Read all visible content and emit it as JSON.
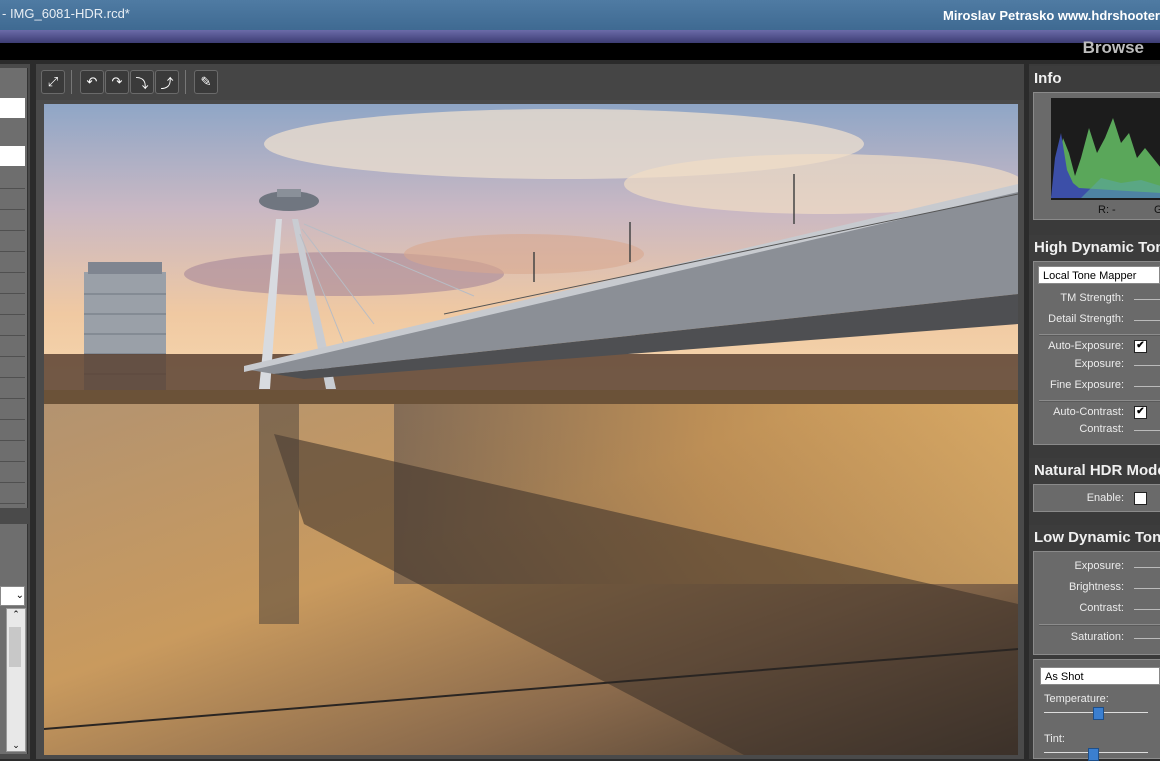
{
  "window": {
    "title": "- IMG_6081-HDR.rcd*",
    "author": "Miroslav  Petrasko  www.hdrshooter"
  },
  "header": {
    "browse_label": "Browse"
  },
  "toolbar": {
    "buttons": [
      "fit-to-window-icon",
      "rotate-left-icon",
      "rotate-right-icon",
      "flip-vertical-icon",
      "flip-horizontal-icon",
      "eyedropper-icon"
    ]
  },
  "info": {
    "title": "Info",
    "r_label": "R: -",
    "g_label": "G"
  },
  "hdr_tone": {
    "title": "High Dynamic Ton",
    "mapper": "Local Tone Mapper",
    "tm_strength": "TM Strength:",
    "detail_strength": "Detail Strength:",
    "auto_exposure": "Auto-Exposure:",
    "auto_exposure_checked": true,
    "exposure": "Exposure:",
    "fine_exposure": "Fine Exposure:",
    "auto_contrast": "Auto-Contrast:",
    "auto_contrast_checked": true,
    "contrast": "Contrast:"
  },
  "natural": {
    "title": "Natural HDR Mode",
    "enable": "Enable:",
    "enable_checked": false
  },
  "ldr_tone": {
    "title": "Low Dynamic Tone",
    "exposure": "Exposure:",
    "brightness": "Brightness:",
    "contrast": "Contrast:",
    "saturation": "Saturation:"
  },
  "white_balance": {
    "preset": "As Shot",
    "temperature": "Temperature:",
    "tint": "Tint:"
  },
  "colors": {
    "title_bar": "#4a76a0",
    "panel_bg": "#6a6a6a",
    "histogram_green": "#5aa75a",
    "histogram_blue": "#3c4fa8"
  }
}
